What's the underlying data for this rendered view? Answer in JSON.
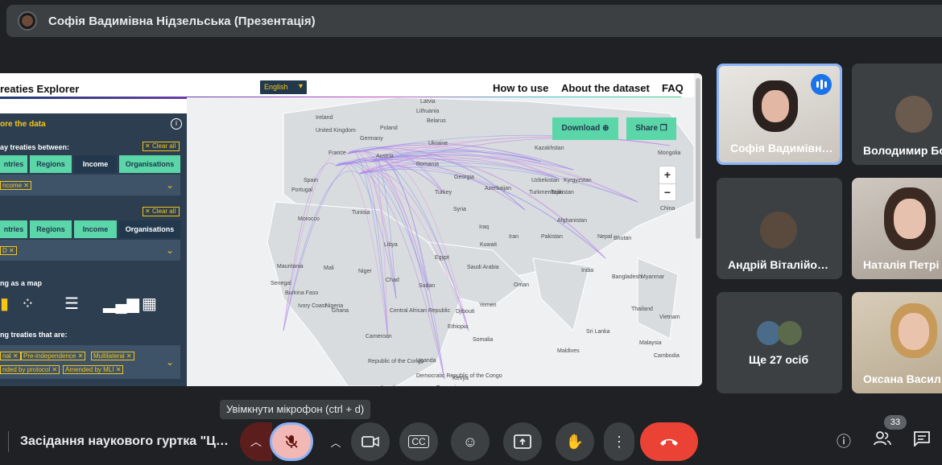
{
  "topbar": {
    "title": "Софія Вадимівна Нідзельська (Презентація)"
  },
  "shared_screen": {
    "app_title": "reaties Explorer",
    "language": "English",
    "nav": [
      "How to use",
      "About the dataset",
      "FAQ"
    ],
    "panel": {
      "heading": "ore the data",
      "section1_label": "ay treaties between:",
      "clear_all": "Clear all",
      "tabs_row1": [
        "ntries",
        "Regions",
        "Income",
        "Organisations"
      ],
      "row1_chip": "ncome",
      "tabs_row2": [
        "ntries",
        "Regions",
        "Income",
        "Organisations"
      ],
      "row2_chip": "D",
      "viz_label": "ng as a map",
      "treaties_label": "ng treaties that are:",
      "treaty_chips": [
        "nal",
        "Pre-independence",
        "Multilateral",
        "nded by protocol",
        "Amended by MLI"
      ]
    },
    "download": "Download",
    "share": "Share",
    "zoom_in": "+",
    "zoom_out": "−",
    "countries": [
      "Latvia",
      "Lithuania",
      "Belarus",
      "Ireland",
      "United Kingdom",
      "Germany",
      "Poland",
      "Ukraine",
      "Kazakhstan",
      "Mongolia",
      "France",
      "Austria",
      "Romania",
      "Spain",
      "Portugal",
      "Georgia",
      "Uzbekistan",
      "Kyrgyzstan",
      "Azerbaijan",
      "Turkmenistan",
      "Tajikistan",
      "China",
      "Turkey",
      "Tunisia",
      "Morocco",
      "Syria",
      "Iraq",
      "Iran",
      "Afghanistan",
      "Pakistan",
      "Nepal",
      "Bhutan",
      "Kuwait",
      "Libya",
      "Egypt",
      "Mauritania",
      "Mali",
      "Niger",
      "Chad",
      "Sudan",
      "Saudi Arabia",
      "India",
      "Bangladesh",
      "Myanmar",
      "Senegal",
      "Burkina Faso",
      "Nigeria",
      "Yemen",
      "Djibouti",
      "Thailand",
      "Vietnam",
      "Cambodia",
      "Ivory Coast",
      "Ghana",
      "Central African Republic",
      "Ethiopia",
      "Somalia",
      "Sri Lanka",
      "Maldives",
      "Malaysia",
      "Cameroon",
      "Uganda",
      "Republic of the Congo",
      "Democratic Republic of the Congo",
      "Kenya",
      "Tanzania",
      "Angola",
      "Oman"
    ]
  },
  "participants": [
    {
      "name": "Софія Вадимівн…"
    },
    {
      "name": "Володимир Бо"
    },
    {
      "name": "Андрій Віталійо…"
    },
    {
      "name": "Наталія Петрі"
    },
    {
      "name": "Ще 27 осіб"
    },
    {
      "name": "Оксана Васил"
    }
  ],
  "controls": {
    "tooltip": "Увімкнути мікрофон (ctrl + d)",
    "meeting_name": "Засідання наукового гуртка \"Ц…",
    "participants_count": "33"
  }
}
